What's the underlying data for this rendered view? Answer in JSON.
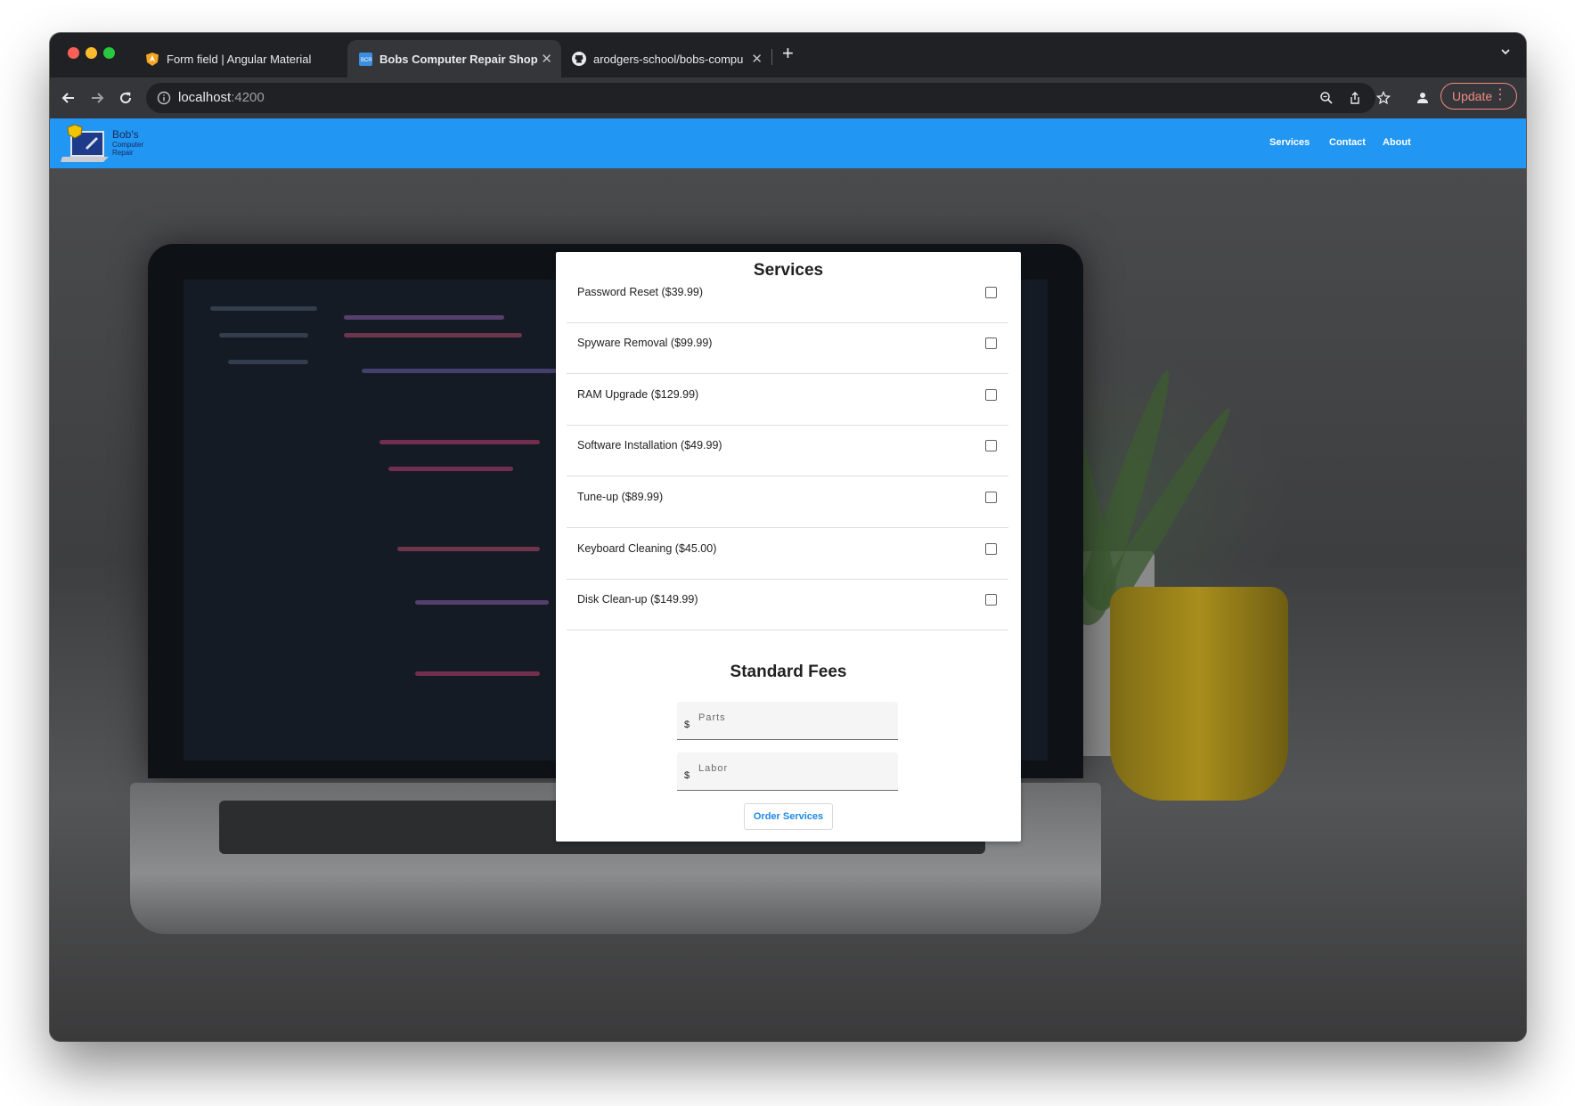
{
  "browser": {
    "tabs": [
      {
        "title": "Form field | Angular Material",
        "icon": "angular-shield-icon",
        "active": false
      },
      {
        "title": "Bobs Computer Repair Shop",
        "icon": "bcr-favicon-icon",
        "active": true
      },
      {
        "title": "arodgers-school/bobs-compu",
        "icon": "github-icon",
        "active": false
      }
    ],
    "url_host": "localhost",
    "url_port": ":4200",
    "update_label": "Update"
  },
  "app": {
    "logo_line1": "Bob's",
    "logo_line2": "Computer Repair",
    "nav": [
      {
        "label": "Services"
      },
      {
        "label": "Contact"
      },
      {
        "label": "About"
      }
    ],
    "accent_color": "#2196f3"
  },
  "services_card": {
    "title": "Services",
    "services": [
      {
        "label": "Password Reset ($39.99)",
        "checked": false
      },
      {
        "label": "Spyware Removal ($99.99)",
        "checked": false
      },
      {
        "label": "RAM Upgrade ($129.99)",
        "checked": false
      },
      {
        "label": "Software Installation ($49.99)",
        "checked": false
      },
      {
        "label": "Tune-up ($89.99)",
        "checked": false
      },
      {
        "label": "Keyboard Cleaning ($45.00)",
        "checked": false
      },
      {
        "label": "Disk Clean-up ($149.99)",
        "checked": false
      }
    ],
    "fees_title": "Standard Fees",
    "parts": {
      "prefix": "$",
      "placeholder": "Parts",
      "value": ""
    },
    "labor": {
      "prefix": "$",
      "placeholder": "Labor",
      "value": ""
    },
    "order_button": "Order Services"
  }
}
